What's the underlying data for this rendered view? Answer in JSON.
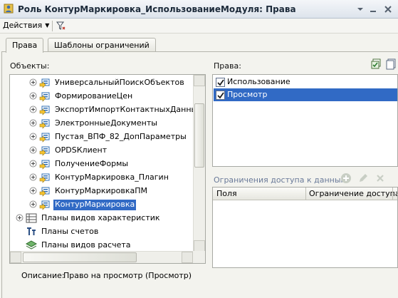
{
  "window": {
    "title": "Роль КонтурМаркировка_ИспользованиеМодуля: Права",
    "app_icon": "role-icon",
    "controls": [
      "menu-icon",
      "minimize-icon",
      "close-icon"
    ]
  },
  "toolbar": {
    "actions_label": "Действия",
    "filter_icon": "filter-icon"
  },
  "tabs": [
    {
      "label": "Права",
      "active": true
    },
    {
      "label": "Шаблоны ограничений",
      "active": false
    }
  ],
  "objects": {
    "label": "Объекты:",
    "items": [
      {
        "label": "УниверсальныйПоискОбъектов",
        "icon": "common-module-icon",
        "expandable": true,
        "selected": false
      },
      {
        "label": "ФормированиеЦен",
        "icon": "common-module-icon",
        "expandable": true,
        "selected": false
      },
      {
        "label": "ЭкспортИмпортКонтактныхДанныхОб",
        "icon": "common-module-icon",
        "expandable": true,
        "selected": false
      },
      {
        "label": "ЭлектронныеДокументы",
        "icon": "common-module-icon",
        "expandable": true,
        "selected": false
      },
      {
        "label": "Пустая_ВПФ_82_ДопПараметры",
        "icon": "common-module-icon",
        "expandable": true,
        "selected": false
      },
      {
        "label": "OPDSКлиент",
        "icon": "common-module-icon",
        "expandable": true,
        "selected": false
      },
      {
        "label": "ПолучениеФормы",
        "icon": "common-module-icon",
        "expandable": true,
        "selected": false
      },
      {
        "label": "КонтурМаркировка_Плагин",
        "icon": "common-module-icon",
        "expandable": true,
        "selected": false
      },
      {
        "label": "КонтурМаркировкаПМ",
        "icon": "common-module-icon",
        "expandable": true,
        "selected": false
      },
      {
        "label": "КонтурМаркировка",
        "icon": "common-module-icon",
        "expandable": true,
        "selected": true
      },
      {
        "label": "Планы видов характеристик",
        "icon": "chart-of-characteristics-icon",
        "expandable": true,
        "selected": false
      },
      {
        "label": "Планы счетов",
        "icon": "chart-of-accounts-icon",
        "expandable": false,
        "selected": false
      },
      {
        "label": "Планы видов расчета",
        "icon": "chart-of-calculation-icon",
        "expandable": false,
        "selected": false
      }
    ]
  },
  "rights": {
    "label": "Права:",
    "items": [
      {
        "label": "Использование",
        "checked": true,
        "selected": false
      },
      {
        "label": "Просмотр",
        "checked": true,
        "selected": true
      }
    ],
    "toolbar_icons": [
      "set-all-rights-icon",
      "copy-rights-icon"
    ]
  },
  "restrictions": {
    "label": "Ограничения доступа к данным:",
    "toolbar_icons": [
      "add-icon",
      "edit-icon",
      "delete-icon"
    ],
    "columns": [
      "Поля",
      "Ограничение доступа"
    ],
    "rows": []
  },
  "description": {
    "label": "Описание:",
    "text": "Право на просмотр (Просмотр)"
  },
  "colors": {
    "selection": "#316ac5",
    "module_icon_blue": "#2f6fb5",
    "module_icon_yellow": "#f5c330"
  }
}
